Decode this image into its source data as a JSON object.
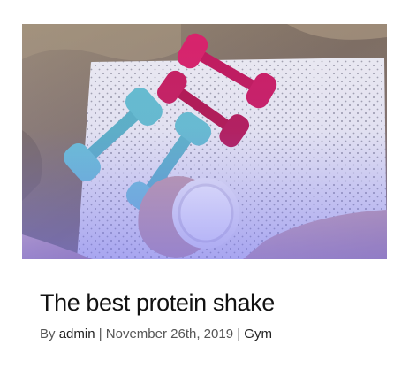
{
  "post": {
    "image_alt": "Dumbbells and a protein shaker on a mat",
    "title": "The best protein shake",
    "meta": {
      "by": "By ",
      "author": "admin",
      "sep1": " | ",
      "date": "November 26th, 2019",
      "sep2": " | ",
      "category": "Gym"
    }
  },
  "colors": {
    "title": "#111111",
    "meta_text": "#555555",
    "meta_link": "#222222",
    "image_overlay": "#6f6cf0",
    "dumbbell_pink": "#d8236a",
    "dumbbell_blue": "#6cc5d4"
  }
}
